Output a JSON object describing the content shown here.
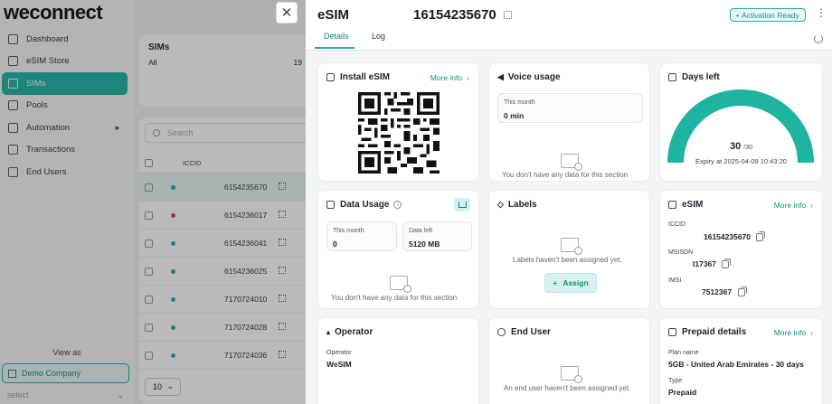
{
  "app": {
    "logo": "weconnect",
    "nav": [
      {
        "label": "Dashboard",
        "icon": "dashboard-icon"
      },
      {
        "label": "eSIM Store",
        "icon": "store-icon"
      },
      {
        "label": "SIMs",
        "icon": "sim-icon",
        "active": true
      },
      {
        "label": "Pools",
        "icon": "pools-icon"
      },
      {
        "label": "Automation",
        "icon": "automation-icon",
        "has_children": true
      },
      {
        "label": "Transactions",
        "icon": "transactions-icon"
      },
      {
        "label": "End Users",
        "icon": "users-icon"
      }
    ],
    "view_as_label": "View as",
    "company": "Demo Company",
    "user_select_placeholder": "select",
    "sims_card": {
      "title": "SIMs",
      "row_label": "All",
      "row_count": "19"
    },
    "table": {
      "search_placeholder": "Search",
      "iccid_header": "ICCID",
      "rows": [
        {
          "iccid": "6154235670",
          "status_color": "#1fb3a2",
          "selected": true
        },
        {
          "iccid": "6154236017",
          "status_color": "#e0384a"
        },
        {
          "iccid": "6154236041",
          "status_color": "#1fb3a2"
        },
        {
          "iccid": "6154236025",
          "status_color": "#1fb3a2"
        },
        {
          "iccid": "7170724010",
          "status_color": "#1fb3a2"
        },
        {
          "iccid": "7170724028",
          "status_color": "#1fb3a2"
        },
        {
          "iccid": "7170724036",
          "status_color": "#1fb3a2"
        }
      ],
      "page_size": "10"
    }
  },
  "drawer": {
    "title": "eSIM",
    "number": "16154235670",
    "status": "Activation Ready",
    "tabs": {
      "details": "Details",
      "log": "Log"
    },
    "install": {
      "title": "Install eSIM",
      "more_info": "More info"
    },
    "voice": {
      "title": "Voice usage",
      "this_month_label": "This month",
      "this_month_value": "0 min",
      "empty": "You don't have any data for this section"
    },
    "days": {
      "title": "Days left",
      "value": "30",
      "total": "/30",
      "remaining_fraction": 1.0,
      "expiry": "Expiry at 2025-04-09 10:43:20"
    },
    "data_usage": {
      "title": "Data Usage",
      "this_month_label": "This month",
      "this_month_value": "0",
      "data_left_label": "Data left",
      "data_left_value": "5120 MB",
      "empty": "You don't have any data for this section"
    },
    "labels": {
      "title": "Labels",
      "empty": "Labels haven't been assigned yet.",
      "assign": "Assign"
    },
    "esim": {
      "title": "eSIM",
      "more_info": "More info",
      "iccid_label": "ICCID",
      "iccid_value": "16154235670",
      "msisdn_label": "MSISDN",
      "msisdn_value": "I17367",
      "imsi_label": "IMSI",
      "imsi_value": "7512367"
    },
    "operator": {
      "title": "Operator",
      "label": "Operator",
      "value": "WeSIM"
    },
    "end_user": {
      "title": "End User",
      "empty": "An end user haven't been assigned yet."
    },
    "prepaid": {
      "title": "Prepaid details",
      "more_info": "More info",
      "plan_label": "Plan name",
      "plan_value": "5GB - United Arab Emirates - 30 days",
      "type_label": "Type",
      "type_value": "Prepaid"
    }
  },
  "colors": {
    "accent": "#1fb3a2",
    "accent_dark": "#138c7e",
    "error": "#e0384a"
  }
}
